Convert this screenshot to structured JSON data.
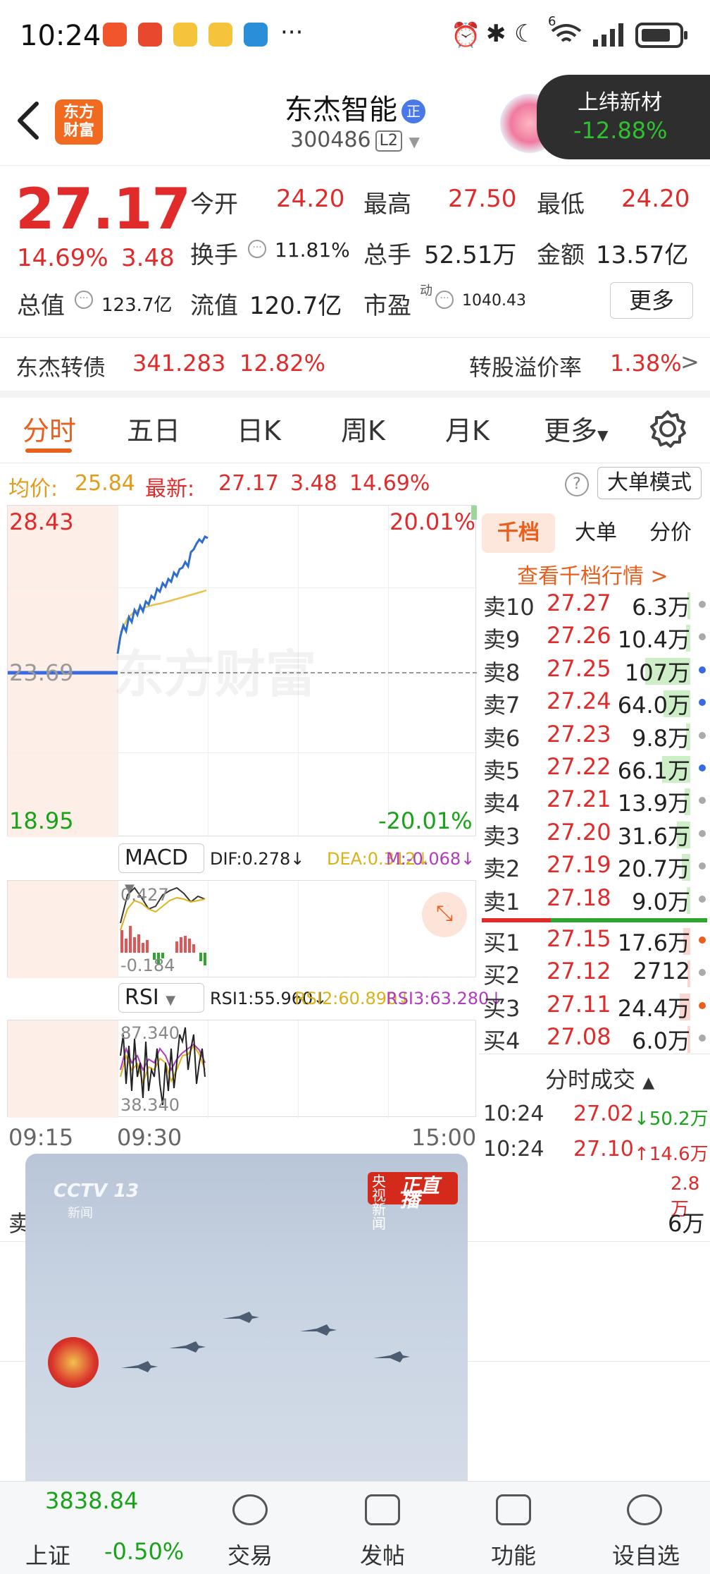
{
  "status_bar": {
    "time": "10:24",
    "battery": "",
    "signal": "6"
  },
  "header": {
    "stock_name": "东杰智能",
    "badge": "正",
    "code": "300486",
    "level": "L2",
    "logo_text_1": "东方",
    "logo_text_2": "财富",
    "float_name": "上纬新材",
    "float_pct": "-12.88%"
  },
  "quote": {
    "price": "27.17",
    "change_pct": "14.69%",
    "change": "3.48",
    "open_label": "今开",
    "open": "24.20",
    "high_label": "最高",
    "high": "27.50",
    "low_label": "最低",
    "low": "24.20",
    "turnover_label": "换手",
    "turnover": "11.81%",
    "volume_label": "总手",
    "volume": "52.51万",
    "amount_label": "金额",
    "amount": "13.57亿",
    "mcap_label": "总值",
    "mcap": "123.7亿",
    "float_cap_label": "流值",
    "float_cap": "120.7亿",
    "pe_label": "市盈",
    "pe_sup": "动",
    "pe": "1040.43",
    "more_label": "更多"
  },
  "bond": {
    "name": "东杰转债",
    "price": "341.283",
    "pct": "12.82%",
    "premium_label": "转股溢价率",
    "premium": "1.38%",
    "arrow": ">"
  },
  "tabs": [
    "分时",
    "五日",
    "日K",
    "周K",
    "月K",
    "更多"
  ],
  "info": {
    "avg_label": "均价:",
    "avg": "25.84",
    "latest_label": "最新:",
    "latest": "27.17",
    "chg": "3.48",
    "pct": "14.69%",
    "mode_label": "大单模式"
  },
  "chart": {
    "max_price": "28.43",
    "max_pct": "20.01%",
    "mid_price": "23.69",
    "min_price": "18.95",
    "min_pct": "-20.01%",
    "watermark": "东方财富",
    "macd_label": "MACD",
    "dif": "DIF:0.278↓",
    "dea": "DEA:0.312↓",
    "m": "M:-0.068↓",
    "macd_max": "0.427",
    "macd_min": "-0.184",
    "rsi_label": "RSI",
    "rsi1": "RSI1:55.960↓",
    "rsi2": "RSI2:60.890↓",
    "rsi3": "RSI3:63.280↓",
    "rsi_max": "87.340",
    "rsi_min": "38.340",
    "time_start": "09:15",
    "time_open": "09:30",
    "time_end": "15:00"
  },
  "book": {
    "seg": [
      "千档",
      "大单",
      "分价"
    ],
    "link": "查看千档行情 >",
    "asks": [
      {
        "label": "卖10",
        "price": "27.27",
        "qty": "6.3万",
        "fill": 0.06
      },
      {
        "label": "卖9",
        "price": "27.26",
        "qty": "10.4万",
        "fill": 0.1
      },
      {
        "label": "卖8",
        "price": "27.25",
        "qty": "107万",
        "fill": 1.0
      },
      {
        "label": "卖7",
        "price": "27.24",
        "qty": "64.0万",
        "fill": 0.6
      },
      {
        "label": "卖6",
        "price": "27.23",
        "qty": "9.8万",
        "fill": 0.09
      },
      {
        "label": "卖5",
        "price": "27.22",
        "qty": "66.1万",
        "fill": 0.62
      },
      {
        "label": "卖4",
        "price": "27.21",
        "qty": "13.9万",
        "fill": 0.13
      },
      {
        "label": "卖3",
        "price": "27.20",
        "qty": "31.6万",
        "fill": 0.3
      },
      {
        "label": "卖2",
        "price": "27.19",
        "qty": "20.7万",
        "fill": 0.19
      },
      {
        "label": "卖1",
        "price": "27.18",
        "qty": "9.0万",
        "fill": 0.08
      }
    ],
    "bids": [
      {
        "label": "买1",
        "price": "27.15",
        "qty": "17.6万",
        "fill": 0.16
      },
      {
        "label": "买2",
        "price": "27.12",
        "qty": "2712",
        "fill": 0.01
      },
      {
        "label": "买3",
        "price": "27.11",
        "qty": "24.4万",
        "fill": 0.23
      },
      {
        "label": "买4",
        "price": "27.08",
        "qty": "6.0万",
        "fill": 0.06
      }
    ],
    "ticks_label": "分时成交",
    "ticks": [
      {
        "time": "10:24",
        "price": "27.02",
        "vol": "↓50.2万"
      },
      {
        "time": "10:24",
        "price": "27.10",
        "vol": "↑14.6万"
      }
    ],
    "partial_vol": "2.8万",
    "partial_bottom": "6万"
  },
  "video": {
    "channel": "CCTV 13",
    "sub": "新闻",
    "live_a": "央视新闻",
    "live_b": "正直播"
  },
  "nav": {
    "index_value": "3838.84",
    "index_name": "上证",
    "index_pct": "-0.50%",
    "items": [
      "交易",
      "发帖",
      "功能",
      "设自选"
    ]
  },
  "partial_left": "卖"
}
